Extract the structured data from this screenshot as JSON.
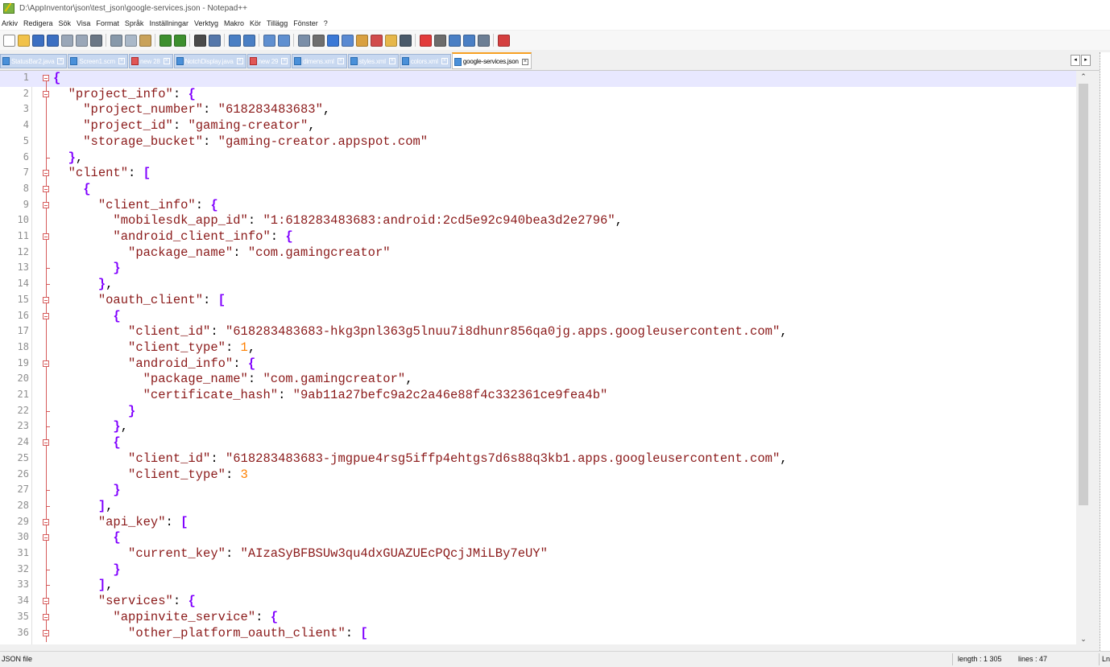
{
  "window": {
    "title": "D:\\AppInventor\\json\\test_json\\google-services.json - Notepad++"
  },
  "menu": [
    "Arkiv",
    "Redigera",
    "Sök",
    "Visa",
    "Format",
    "Språk",
    "Inställningar",
    "Verktyg",
    "Makro",
    "Kör",
    "Tillägg",
    "Fönster",
    "?"
  ],
  "toolbar": {
    "groups": [
      [
        "new-file-icon",
        "open-file-icon",
        "save-icon",
        "save-all-icon",
        "close-icon",
        "close-all-icon",
        "print-icon"
      ],
      [
        "cut-icon",
        "copy-icon",
        "paste-icon"
      ],
      [
        "undo-icon",
        "redo-icon"
      ],
      [
        "find-icon",
        "replace-icon"
      ],
      [
        "zoom-in-icon",
        "zoom-out-icon"
      ],
      [
        "sync-vertical-icon",
        "sync-horizontal-icon"
      ],
      [
        "word-wrap-icon",
        "show-all-chars-icon",
        "indent-guide-icon",
        "user-lang-icon",
        "doc-map-icon",
        "function-list-icon",
        "folder-workspace-icon",
        "monitoring-icon"
      ],
      [
        "record-macro-icon",
        "stop-macro-icon",
        "play-macro-icon",
        "run-macro-multiple-icon",
        "save-macro-icon"
      ],
      [
        "spellcheck-icon"
      ]
    ]
  },
  "tabs": [
    {
      "label": "StatusBar2.java",
      "active": false,
      "modified": false
    },
    {
      "label": "Screen1.scm",
      "active": false,
      "modified": false
    },
    {
      "label": "new 28",
      "active": false,
      "modified": true
    },
    {
      "label": "NotchDisplay.java",
      "active": false,
      "modified": false
    },
    {
      "label": "new 29",
      "active": false,
      "modified": true
    },
    {
      "label": "dimens.xml",
      "active": false,
      "modified": false
    },
    {
      "label": "styles.xml",
      "active": false,
      "modified": false
    },
    {
      "label": "colors.xml",
      "active": false,
      "modified": false
    },
    {
      "label": "google-services.json",
      "active": true,
      "modified": false
    }
  ],
  "editor": {
    "current_line": 1,
    "lines": [
      {
        "n": "1",
        "fold": "open",
        "tokens": [
          [
            "p",
            "{"
          ]
        ]
      },
      {
        "n": "2",
        "fold": "open",
        "tokens": [
          [
            "",
            "  "
          ],
          [
            "s",
            "\"project_info\""
          ],
          [
            "",
            ": "
          ],
          [
            "p",
            "{"
          ]
        ]
      },
      {
        "n": "3",
        "fold": "line",
        "tokens": [
          [
            "",
            "    "
          ],
          [
            "s",
            "\"project_number\""
          ],
          [
            "",
            ": "
          ],
          [
            "s",
            "\"618283483683\""
          ],
          [
            "",
            ","
          ]
        ]
      },
      {
        "n": "4",
        "fold": "line",
        "tokens": [
          [
            "",
            "    "
          ],
          [
            "s",
            "\"project_id\""
          ],
          [
            "",
            ": "
          ],
          [
            "s",
            "\"gaming-creator\""
          ],
          [
            "",
            ","
          ]
        ]
      },
      {
        "n": "5",
        "fold": "line",
        "tokens": [
          [
            "",
            "    "
          ],
          [
            "s",
            "\"storage_bucket\""
          ],
          [
            "",
            ": "
          ],
          [
            "s",
            "\"gaming-creator.appspot.com\""
          ]
        ]
      },
      {
        "n": "6",
        "fold": "end",
        "tokens": [
          [
            "",
            "  "
          ],
          [
            "p",
            "}"
          ],
          [
            "",
            ","
          ]
        ]
      },
      {
        "n": "7",
        "fold": "open",
        "tokens": [
          [
            "",
            "  "
          ],
          [
            "s",
            "\"client\""
          ],
          [
            "",
            ": "
          ],
          [
            "p",
            "["
          ]
        ]
      },
      {
        "n": "8",
        "fold": "open",
        "tokens": [
          [
            "",
            "    "
          ],
          [
            "p",
            "{"
          ]
        ]
      },
      {
        "n": "9",
        "fold": "open",
        "tokens": [
          [
            "",
            "      "
          ],
          [
            "s",
            "\"client_info\""
          ],
          [
            "",
            ": "
          ],
          [
            "p",
            "{"
          ]
        ]
      },
      {
        "n": "10",
        "fold": "line",
        "tokens": [
          [
            "",
            "        "
          ],
          [
            "s",
            "\"mobilesdk_app_id\""
          ],
          [
            "",
            ": "
          ],
          [
            "s",
            "\"1:618283483683:android:2cd5e92c940bea3d2e2796\""
          ],
          [
            "",
            ","
          ]
        ]
      },
      {
        "n": "11",
        "fold": "open",
        "tokens": [
          [
            "",
            "        "
          ],
          [
            "s",
            "\"android_client_info\""
          ],
          [
            "",
            ": "
          ],
          [
            "p",
            "{"
          ]
        ]
      },
      {
        "n": "12",
        "fold": "line",
        "tokens": [
          [
            "",
            "          "
          ],
          [
            "s",
            "\"package_name\""
          ],
          [
            "",
            ": "
          ],
          [
            "s",
            "\"com.gamingcreator\""
          ]
        ]
      },
      {
        "n": "13",
        "fold": "end",
        "tokens": [
          [
            "",
            "        "
          ],
          [
            "p",
            "}"
          ]
        ]
      },
      {
        "n": "14",
        "fold": "end",
        "tokens": [
          [
            "",
            "      "
          ],
          [
            "p",
            "}"
          ],
          [
            "",
            ","
          ]
        ]
      },
      {
        "n": "15",
        "fold": "open",
        "tokens": [
          [
            "",
            "      "
          ],
          [
            "s",
            "\"oauth_client\""
          ],
          [
            "",
            ": "
          ],
          [
            "p",
            "["
          ]
        ]
      },
      {
        "n": "16",
        "fold": "open",
        "tokens": [
          [
            "",
            "        "
          ],
          [
            "p",
            "{"
          ]
        ]
      },
      {
        "n": "17",
        "fold": "line",
        "tokens": [
          [
            "",
            "          "
          ],
          [
            "s",
            "\"client_id\""
          ],
          [
            "",
            ": "
          ],
          [
            "s",
            "\"618283483683-hkg3pnl363g5lnuu7i8dhunr856qa0jg.apps.googleusercontent.com\""
          ],
          [
            "",
            ","
          ]
        ]
      },
      {
        "n": "18",
        "fold": "line",
        "tokens": [
          [
            "",
            "          "
          ],
          [
            "s",
            "\"client_type\""
          ],
          [
            "",
            ": "
          ],
          [
            "n",
            "1"
          ],
          [
            "",
            ","
          ]
        ]
      },
      {
        "n": "19",
        "fold": "open",
        "tokens": [
          [
            "",
            "          "
          ],
          [
            "s",
            "\"android_info\""
          ],
          [
            "",
            ": "
          ],
          [
            "p",
            "{"
          ]
        ]
      },
      {
        "n": "20",
        "fold": "line",
        "tokens": [
          [
            "",
            "            "
          ],
          [
            "s",
            "\"package_name\""
          ],
          [
            "",
            ": "
          ],
          [
            "s",
            "\"com.gamingcreator\""
          ],
          [
            "",
            ","
          ]
        ]
      },
      {
        "n": "21",
        "fold": "line",
        "tokens": [
          [
            "",
            "            "
          ],
          [
            "s",
            "\"certificate_hash\""
          ],
          [
            "",
            ": "
          ],
          [
            "s",
            "\"9ab11a27befc9a2c2a46e88f4c332361ce9fea4b\""
          ]
        ]
      },
      {
        "n": "22",
        "fold": "end",
        "tokens": [
          [
            "",
            "          "
          ],
          [
            "p",
            "}"
          ]
        ]
      },
      {
        "n": "23",
        "fold": "end",
        "tokens": [
          [
            "",
            "        "
          ],
          [
            "p",
            "}"
          ],
          [
            "",
            ","
          ]
        ]
      },
      {
        "n": "24",
        "fold": "open",
        "tokens": [
          [
            "",
            "        "
          ],
          [
            "p",
            "{"
          ]
        ]
      },
      {
        "n": "25",
        "fold": "line",
        "tokens": [
          [
            "",
            "          "
          ],
          [
            "s",
            "\"client_id\""
          ],
          [
            "",
            ": "
          ],
          [
            "s",
            "\"618283483683-jmgpue4rsg5iffp4ehtgs7d6s88q3kb1.apps.googleusercontent.com\""
          ],
          [
            "",
            ","
          ]
        ]
      },
      {
        "n": "26",
        "fold": "line",
        "tokens": [
          [
            "",
            "          "
          ],
          [
            "s",
            "\"client_type\""
          ],
          [
            "",
            ": "
          ],
          [
            "n",
            "3"
          ]
        ]
      },
      {
        "n": "27",
        "fold": "end",
        "tokens": [
          [
            "",
            "        "
          ],
          [
            "p",
            "}"
          ]
        ]
      },
      {
        "n": "28",
        "fold": "end",
        "tokens": [
          [
            "",
            "      "
          ],
          [
            "p",
            "]"
          ],
          [
            "",
            ","
          ]
        ]
      },
      {
        "n": "29",
        "fold": "open",
        "tokens": [
          [
            "",
            "      "
          ],
          [
            "s",
            "\"api_key\""
          ],
          [
            "",
            ": "
          ],
          [
            "p",
            "["
          ]
        ]
      },
      {
        "n": "30",
        "fold": "open",
        "tokens": [
          [
            "",
            "        "
          ],
          [
            "p",
            "{"
          ]
        ]
      },
      {
        "n": "31",
        "fold": "line",
        "tokens": [
          [
            "",
            "          "
          ],
          [
            "s",
            "\"current_key\""
          ],
          [
            "",
            ": "
          ],
          [
            "s",
            "\"AIzaSyBFBSUw3qu4dxGUAZUEcPQcjJMiLBy7eUY\""
          ]
        ]
      },
      {
        "n": "32",
        "fold": "end",
        "tokens": [
          [
            "",
            "        "
          ],
          [
            "p",
            "}"
          ]
        ]
      },
      {
        "n": "33",
        "fold": "end",
        "tokens": [
          [
            "",
            "      "
          ],
          [
            "p",
            "]"
          ],
          [
            "",
            ","
          ]
        ]
      },
      {
        "n": "34",
        "fold": "open",
        "tokens": [
          [
            "",
            "      "
          ],
          [
            "s",
            "\"services\""
          ],
          [
            "",
            ": "
          ],
          [
            "p",
            "{"
          ]
        ]
      },
      {
        "n": "35",
        "fold": "open",
        "tokens": [
          [
            "",
            "        "
          ],
          [
            "s",
            "\"appinvite_service\""
          ],
          [
            "",
            ": "
          ],
          [
            "p",
            "{"
          ]
        ]
      },
      {
        "n": "36",
        "fold": "open",
        "tokens": [
          [
            "",
            "          "
          ],
          [
            "s",
            "\"other_platform_oauth_client\""
          ],
          [
            "",
            ": "
          ],
          [
            "p",
            "["
          ]
        ]
      }
    ]
  },
  "statusbar": {
    "file_type": "JSON file",
    "length": "length : 1 305",
    "lines": "lines : 47",
    "right_fragment": "Ln"
  },
  "colors": {
    "string": "#8b1a1a",
    "punctuation": "#8000ff",
    "number": "#ff8000",
    "active_tab_accent": "#f7a022",
    "fold_marker": "#d65c5c"
  }
}
